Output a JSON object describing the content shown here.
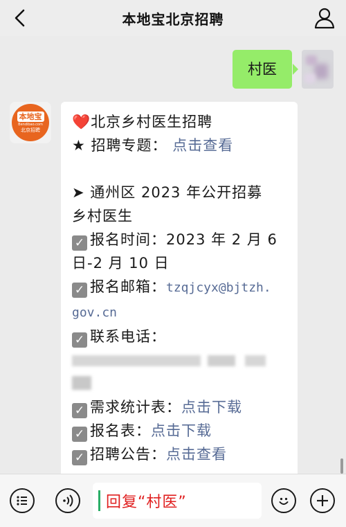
{
  "header": {
    "title": "本地宝北京招聘",
    "back_icon": "back-arrow-icon",
    "profile_icon": "user-icon"
  },
  "outgoing": {
    "text": "村医"
  },
  "bot_avatar": {
    "logo_main": "本地宝",
    "logo_sub": "Bendibao.com",
    "logo_city": "北京招聘"
  },
  "message": {
    "title_icon": "❤️",
    "title": "北京乡村医生招聘",
    "topic_prefix": "★",
    "topic_label": "招聘专题：",
    "topic_link": "点击查看",
    "section_prefix": "➤",
    "section_line1": "通州区 2023 年公开招募",
    "section_line2": "乡村医生",
    "reg_time_label": "报名时间：",
    "reg_time_value1": "2023 年 2 月 6",
    "reg_time_value2": "日-2 月 10 日",
    "email_label": "报名邮箱：",
    "email_value1": "tzqjcyx@bjtzh.",
    "email_value2": "gov.cn",
    "phone_label": "联系电话：",
    "demand_label": "需求统计表：",
    "demand_link": "点击下载",
    "form_label": "报名表：",
    "form_link": "点击下载",
    "notice_label": "招聘公告：",
    "notice_link": "点击查看"
  },
  "input_bar": {
    "text": "回复“村医”"
  },
  "colors": {
    "outgoing_bubble": "#95ec69",
    "link": "#576b95",
    "accent_red": "#e02020",
    "logo_orange": "#e8651f"
  }
}
